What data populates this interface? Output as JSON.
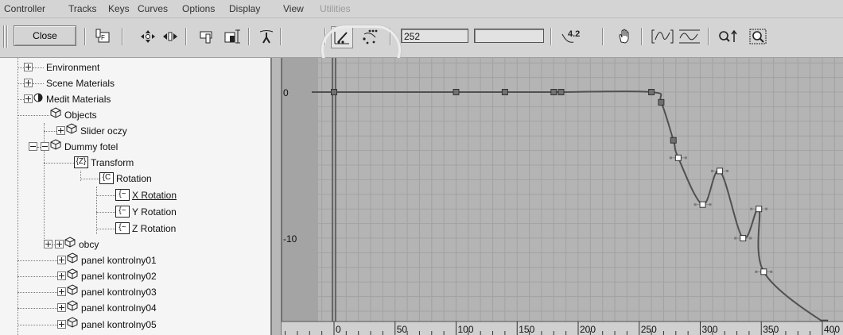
{
  "menu": [
    {
      "label": "Controller",
      "enabled": true
    },
    {
      "label": "Tracks",
      "enabled": true
    },
    {
      "label": "Keys",
      "enabled": true
    },
    {
      "label": "Curves",
      "enabled": true
    },
    {
      "label": "Options",
      "enabled": true
    },
    {
      "label": "Display",
      "enabled": true
    },
    {
      "label": "View",
      "enabled": true
    },
    {
      "label": "Utilities",
      "enabled": false
    }
  ],
  "toolbar": {
    "close_label": "Close",
    "frame_value": "252",
    "value_field": "",
    "value_field2": "",
    "readout_icon_text": "4.2"
  },
  "tree": {
    "items": [
      {
        "label": "Environment"
      },
      {
        "label": "Scene Materials"
      },
      {
        "label": "Medit Materials"
      },
      {
        "label": "Objects"
      },
      {
        "label": "Slider oczy"
      },
      {
        "label": "Dummy fotel"
      },
      {
        "label": "Transform"
      },
      {
        "label": "Rotation"
      },
      {
        "label": "X Rotation"
      },
      {
        "label": "Y Rotation"
      },
      {
        "label": "Z Rotation"
      },
      {
        "label": "obcy"
      },
      {
        "label": "panel kontrolny01"
      },
      {
        "label": "panel kontrolny02"
      },
      {
        "label": "panel kontrolny03"
      },
      {
        "label": "panel kontrolny04"
      },
      {
        "label": "panel kontrolny05"
      }
    ]
  },
  "graph": {
    "y_labels": [
      "0",
      "-10"
    ],
    "ruler_labels": [
      "0",
      "50",
      "100",
      "150",
      "200",
      "250",
      "300",
      "350",
      "400"
    ],
    "current_frame": 0,
    "colors": {
      "curve": "#505050",
      "key_fill": "#ffffff",
      "key_selected": "#707070",
      "range": "#b4b4b4",
      "outside": "#9a9a9a"
    },
    "keys": [
      {
        "frame": 0,
        "value": 0
      },
      {
        "frame": 100,
        "value": 0
      },
      {
        "frame": 140,
        "value": 0
      },
      {
        "frame": 180,
        "value": 0
      },
      {
        "frame": 186,
        "value": 0
      },
      {
        "frame": 260,
        "value": 0
      },
      {
        "frame": 268,
        "value": -0.7
      },
      {
        "frame": 278,
        "value": -3.3
      },
      {
        "frame": 282,
        "value": -4.5
      },
      {
        "frame": 302,
        "value": -7.7
      },
      {
        "frame": 316,
        "value": -5.4
      },
      {
        "frame": 335,
        "value": -10.0
      },
      {
        "frame": 348,
        "value": -8.0
      },
      {
        "frame": 352,
        "value": -12.3
      },
      {
        "frame": 402,
        "value": -15.8
      }
    ]
  }
}
